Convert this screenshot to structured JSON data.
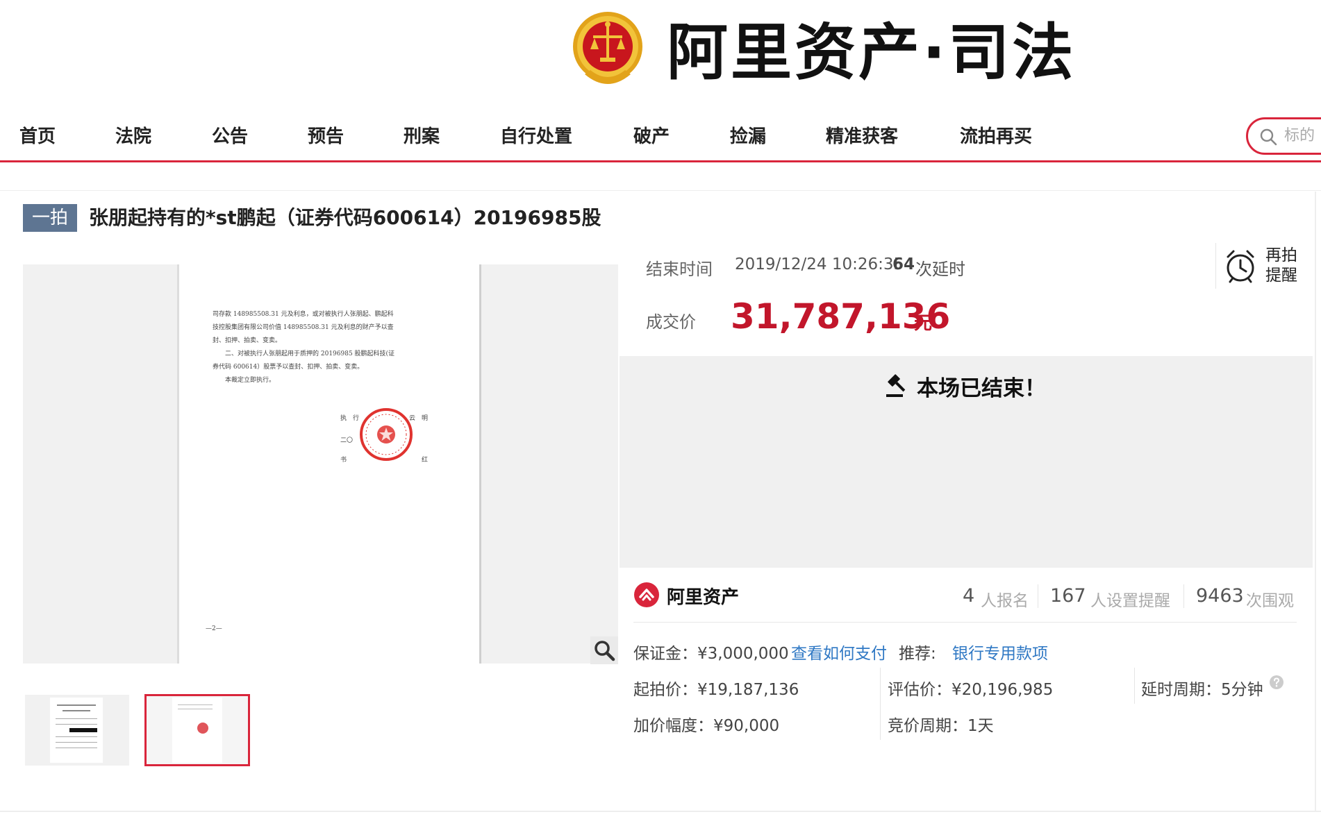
{
  "header": {
    "brand": "阿里资产·司法"
  },
  "nav": {
    "items": [
      "首页",
      "法院",
      "公告",
      "预告",
      "刑案",
      "自行处置",
      "破产",
      "捡漏",
      "精准获客",
      "流拍再买"
    ],
    "search_placeholder": "标的"
  },
  "auction": {
    "round_badge": "一拍",
    "title": "张朋起持有的*st鹏起（证券代码600614）20196985股",
    "end_time_label": "结束时间",
    "end_time": "2019/12/24 10:26:35",
    "delay_count": "64",
    "delay_label": "次延时",
    "remind_label": "再拍提醒",
    "deal_price_label": "成交价",
    "deal_price": "31,787,136",
    "deal_price_unit": "元",
    "status": "本场已结束！"
  },
  "platform": {
    "name": "阿里资产",
    "stats": [
      {
        "value": "4",
        "label": "人报名"
      },
      {
        "value": "167",
        "label": "人设置提醒"
      },
      {
        "value": "9463",
        "label": "次围观"
      }
    ]
  },
  "details": {
    "deposit": "保证金：¥3,000,000",
    "how_to_pay": "查看如何支付",
    "recommend_label": "推荐:",
    "bank_item": "银行专用款项",
    "start_price": "起拍价：¥19,187,136",
    "appraisal": "评估价：¥20,196,985",
    "delay_period": "延时周期：5分钟",
    "increment": "加价幅度：¥90,000",
    "bid_period": "竞价周期：1天"
  },
  "document": {
    "lines": [
      "司存款 148985508.31 元及利息，或对被执行人张朋起、鹏起科",
      "技控股集团有限公司价值 148985508.31 元及利息的财产予以查",
      "封、扣押、拍卖、变卖。",
      "　　二、对被执行人张朋起用于质押的 20196985 股鹏起科技(证",
      "券代码 600614）股票予以查封、扣押、拍卖、变卖。",
      "　　本裁定立即执行。"
    ],
    "sign_1": "执　行　　　　　　　　云　明",
    "sign_2": "二〇",
    "sign_3": "书　　　　　　　　　　　　红",
    "page_no": "—2—"
  },
  "colors": {
    "brand_red": "#d9253b",
    "price_red": "#c2162b",
    "link_blue": "#2f78c4",
    "badge_blue": "#5e7592"
  }
}
